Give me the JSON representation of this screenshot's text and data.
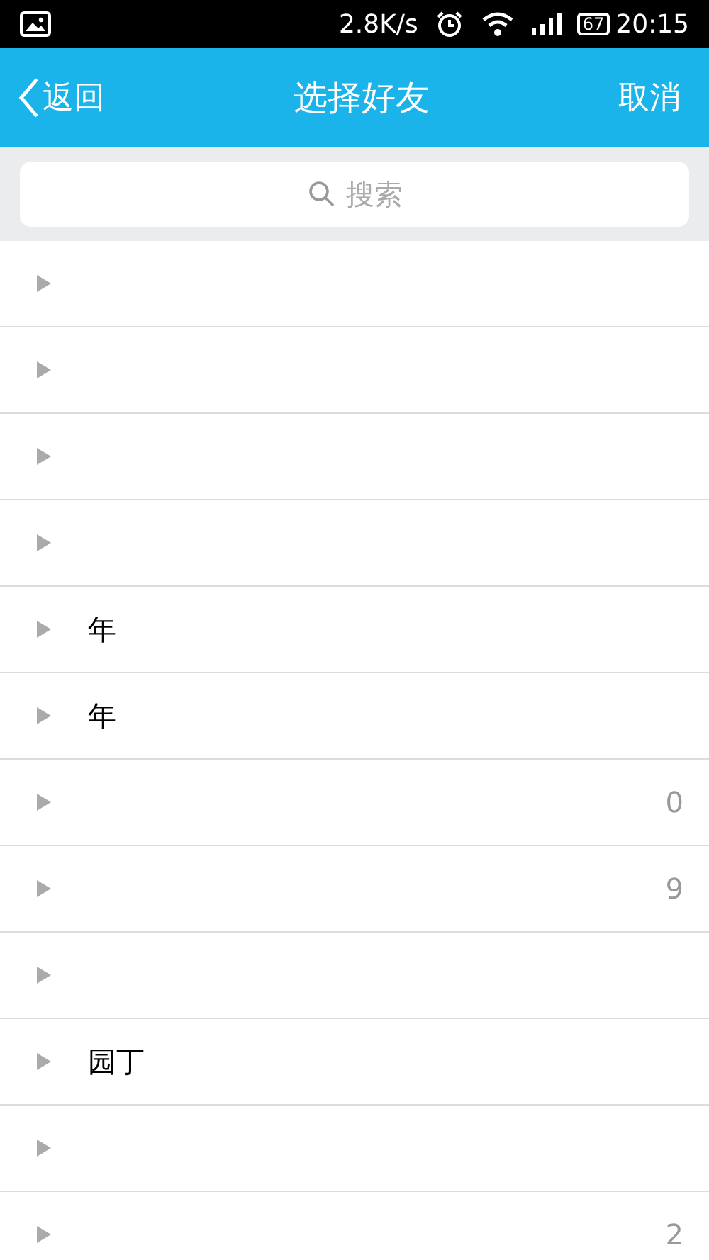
{
  "status_bar": {
    "speed": "2.8K/s",
    "battery": "67",
    "time": "20:15"
  },
  "nav": {
    "back": "返回",
    "title": "选择好友",
    "cancel": "取消"
  },
  "search": {
    "placeholder": "搜索"
  },
  "groups": [
    {
      "expanded": false
    },
    {
      "expanded": false
    },
    {
      "expanded": false
    },
    {
      "expanded": false
    },
    {
      "expanded": false,
      "name": "年"
    },
    {
      "expanded": false,
      "name": "年"
    },
    {
      "expanded": false,
      "count": "0"
    },
    {
      "expanded": false,
      "count": "9"
    },
    {
      "expanded": false
    },
    {
      "expanded": false,
      "name": "园丁"
    },
    {
      "expanded": false
    },
    {
      "expanded": false,
      "count": "2"
    }
  ]
}
